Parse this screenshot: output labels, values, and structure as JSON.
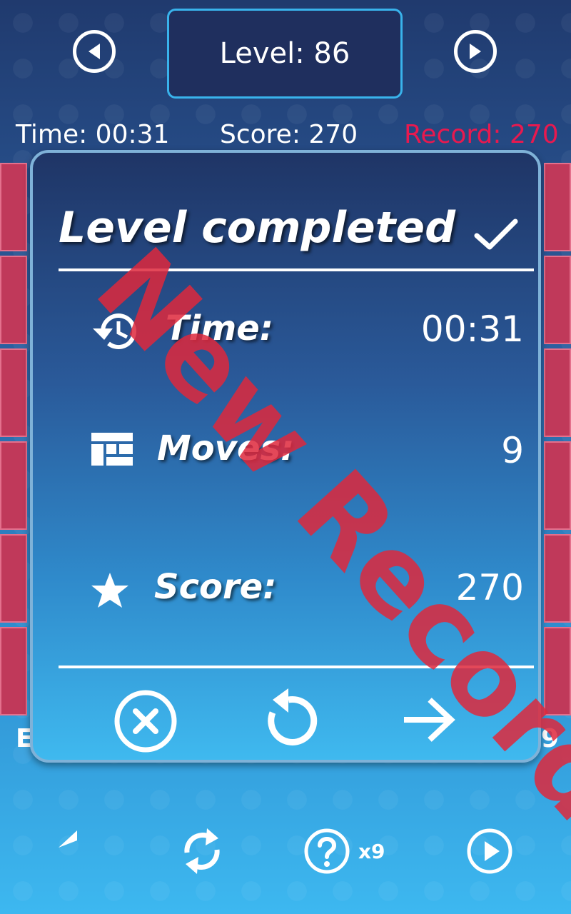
{
  "header": {
    "level_label": "Level: 86",
    "prev_icon": "prev-level-icon",
    "next_icon": "next-level-icon"
  },
  "stats": {
    "time": "Time: 00:31",
    "score": "Score: 270",
    "record": "Record: 270"
  },
  "side": {
    "left_text": "E",
    "right_text": "9"
  },
  "dialog": {
    "title": "Level completed",
    "rows": [
      {
        "label": "Time:",
        "value": "00:31",
        "icon": "history-icon"
      },
      {
        "label": "Moves:",
        "value": "9",
        "icon": "moves-grid-icon"
      },
      {
        "label": "Score:",
        "value": "270",
        "icon": "star-icon"
      }
    ],
    "watermark": "New Record",
    "buttons": [
      "close-icon",
      "replay-icon",
      "next-arrow-icon"
    ]
  },
  "toolbar": {
    "hint_count": "x9",
    "icons": [
      "undo-icon",
      "restart-icon",
      "hint-icon",
      "play-icon"
    ]
  },
  "colors": {
    "record": "#e8194f",
    "tile": "#c0395a",
    "frame": "#39b3ec"
  }
}
